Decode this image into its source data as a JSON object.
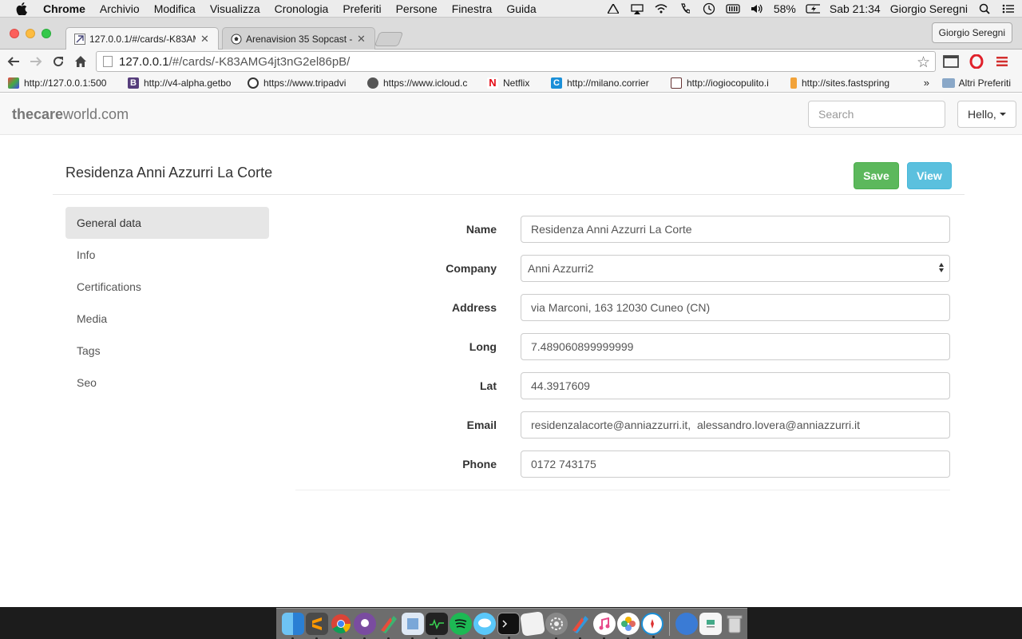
{
  "os_menubar": {
    "app_name": "Chrome",
    "menus": [
      "Archivio",
      "Modifica",
      "Visualizza",
      "Cronologia",
      "Preferiti",
      "Persone",
      "Finestra",
      "Guida"
    ],
    "battery": "58%",
    "clock": "Sab 21:34",
    "user": "Giorgio Seregni"
  },
  "browser": {
    "tabs": [
      {
        "title": "127.0.0.1/#/cards/-K83AM",
        "active": true
      },
      {
        "title": "Arenavision 35 Sopcast - L",
        "active": false
      }
    ],
    "profile": "Giorgio Seregni",
    "url_host": "127.0.0.1",
    "url_path": "/#/cards/-K83AMG4jt3nG2el86pB/",
    "bookmarks": [
      "http://127.0.0.1:500",
      "http://v4-alpha.getbo",
      "https://www.tripadvi",
      "https://www.icloud.c",
      "Netflix",
      "http://milano.corrier",
      "http://iogiocopulito.i",
      "http://sites.fastspring"
    ],
    "bookmarks_more": "»",
    "other_bookmarks": "Altri Preferiti"
  },
  "site": {
    "brand_bold": "thecare",
    "brand_rest": "world.com",
    "search_placeholder": "Search",
    "user_menu": "Hello,"
  },
  "card": {
    "title": "Residenza Anni Azzurri La Corte",
    "save_label": "Save",
    "view_label": "View"
  },
  "sidenav": {
    "items": [
      {
        "label": "General data",
        "active": true
      },
      {
        "label": "Info",
        "active": false
      },
      {
        "label": "Certifications",
        "active": false
      },
      {
        "label": "Media",
        "active": false
      },
      {
        "label": "Tags",
        "active": false
      },
      {
        "label": "Seo",
        "active": false
      }
    ]
  },
  "form": {
    "name": {
      "label": "Name",
      "value": "Residenza Anni Azzurri La Corte"
    },
    "company": {
      "label": "Company",
      "value": "Anni Azzurri2"
    },
    "address": {
      "label": "Address",
      "value": "via Marconi, 163 12030 Cuneo (CN)"
    },
    "long": {
      "label": "Long",
      "value": "7.489060899999999"
    },
    "lat": {
      "label": "Lat",
      "value": "44.3917609"
    },
    "email": {
      "label": "Email",
      "value": "residenzalacorte@anniazzurri.it,  alessandro.lovera@anniazzurri.it"
    },
    "phone": {
      "label": "Phone",
      "value": "0172 743175"
    }
  },
  "colors": {
    "save": "#5cb85c",
    "view": "#5bc0de",
    "active_nav": "#e6e6e6"
  },
  "dock_icons": [
    "finder-icon",
    "sublime-icon",
    "chrome-icon",
    "github-icon",
    "app-icon",
    "preview-icon",
    "activity-monitor-icon",
    "spotify-icon",
    "messages-icon",
    "terminal-icon",
    "textedit-icon",
    "system-preferences-icon",
    "app-icon-2",
    "itunes-icon",
    "photos-icon",
    "safari-icon",
    "network-icon",
    "document-icon",
    "trash-icon"
  ]
}
